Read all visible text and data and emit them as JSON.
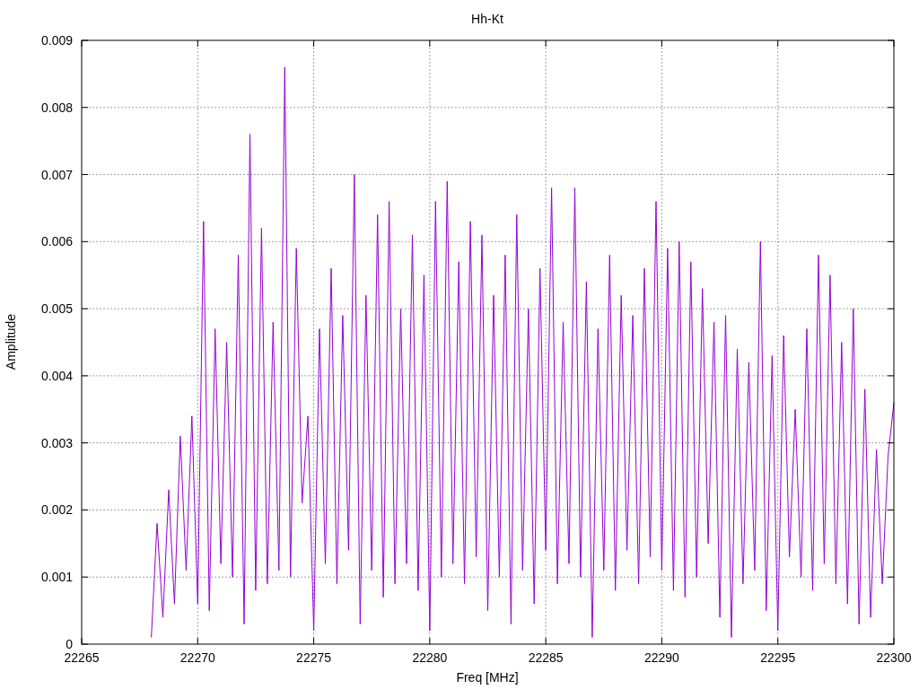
{
  "chart_data": {
    "type": "line",
    "title": "Hh-Kt",
    "xlabel": "Freq [MHz]",
    "ylabel": "Amplitude",
    "xlim": [
      22265,
      22300
    ],
    "ylim": [
      0,
      0.009
    ],
    "grid": true,
    "xticks": [
      22265,
      22270,
      22275,
      22280,
      22285,
      22290,
      22295,
      22300
    ],
    "yticks": [
      {
        "value": 0,
        "label": "0"
      },
      {
        "value": 0.001,
        "label": "0.001"
      },
      {
        "value": 0.002,
        "label": "0.002"
      },
      {
        "value": 0.003,
        "label": "0.003"
      },
      {
        "value": 0.004,
        "label": "0.004"
      },
      {
        "value": 0.005,
        "label": "0.005"
      },
      {
        "value": 0.006,
        "label": "0.006"
      },
      {
        "value": 0.007,
        "label": "0.007"
      },
      {
        "value": 0.008,
        "label": "0.008"
      },
      {
        "value": 0.009,
        "label": "0.009"
      }
    ],
    "x": [
      22268,
      22268.25,
      22268.5,
      22268.75,
      22269,
      22269.25,
      22269.5,
      22269.75,
      22270,
      22270.25,
      22270.5,
      22270.75,
      22271,
      22271.25,
      22271.5,
      22271.75,
      22272,
      22272.25,
      22272.5,
      22272.75,
      22273,
      22273.25,
      22273.5,
      22273.75,
      22274,
      22274.25,
      22274.5,
      22274.75,
      22275,
      22275.25,
      22275.5,
      22275.75,
      22276,
      22276.25,
      22276.5,
      22276.75,
      22277,
      22277.25,
      22277.5,
      22277.75,
      22278,
      22278.25,
      22278.5,
      22278.75,
      22279,
      22279.25,
      22279.5,
      22279.75,
      22280,
      22280.25,
      22280.5,
      22280.75,
      22281,
      22281.25,
      22281.5,
      22281.75,
      22282,
      22282.25,
      22282.5,
      22282.75,
      22283,
      22283.25,
      22283.5,
      22283.75,
      22284,
      22284.25,
      22284.5,
      22284.75,
      22285,
      22285.25,
      22285.5,
      22285.75,
      22286,
      22286.25,
      22286.5,
      22286.75,
      22287,
      22287.25,
      22287.5,
      22287.75,
      22288,
      22288.25,
      22288.5,
      22288.75,
      22289,
      22289.25,
      22289.5,
      22289.75,
      22290,
      22290.25,
      22290.5,
      22290.75,
      22291,
      22291.25,
      22291.5,
      22291.75,
      22292,
      22292.25,
      22292.5,
      22292.75,
      22293,
      22293.25,
      22293.5,
      22293.75,
      22294,
      22294.25,
      22294.5,
      22294.75,
      22295,
      22295.25,
      22295.5,
      22295.75,
      22296,
      22296.25,
      22296.5,
      22296.75,
      22297,
      22297.25,
      22297.5,
      22297.75,
      22298,
      22298.25,
      22298.5,
      22298.75,
      22299,
      22299.25,
      22299.5,
      22299.75,
      22300
    ],
    "series": [
      {
        "color": "#9400d3",
        "values": [
          0.0001,
          0.0018,
          0.0004,
          0.0023,
          0.0006,
          0.0031,
          0.0011,
          0.0034,
          0.0006,
          0.0063,
          0.0005,
          0.0047,
          0.0012,
          0.0045,
          0.001,
          0.0058,
          0.0003,
          0.0076,
          0.0008,
          0.0062,
          0.0009,
          0.0048,
          0.0011,
          0.0086,
          0.001,
          0.0059,
          0.0021,
          0.0034,
          0.0002,
          0.0047,
          0.0012,
          0.0056,
          0.0009,
          0.0049,
          0.0014,
          0.007,
          0.0003,
          0.0052,
          0.0011,
          0.0064,
          0.0007,
          0.0066,
          0.0009,
          0.005,
          0.0012,
          0.0061,
          0.0008,
          0.0055,
          0.0002,
          0.0066,
          0.001,
          0.0069,
          0.0012,
          0.0057,
          0.0009,
          0.0063,
          0.0013,
          0.0061,
          0.0005,
          0.0052,
          0.001,
          0.0058,
          0.0003,
          0.0064,
          0.0011,
          0.005,
          0.0006,
          0.0056,
          0.0014,
          0.0068,
          0.0009,
          0.0048,
          0.0012,
          0.0068,
          0.001,
          0.0054,
          0.0001,
          0.0047,
          0.0011,
          0.0058,
          0.0008,
          0.0052,
          0.0014,
          0.0049,
          0.0009,
          0.0056,
          0.0013,
          0.0066,
          0.0011,
          0.0059,
          0.0008,
          0.006,
          0.0007,
          0.0057,
          0.001,
          0.0053,
          0.0015,
          0.0048,
          0.0004,
          0.0049,
          0.0001,
          0.0044,
          0.0009,
          0.0042,
          0.0011,
          0.006,
          0.0005,
          0.0043,
          0.0002,
          0.0046,
          0.0013,
          0.0035,
          0.001,
          0.0047,
          0.0008,
          0.0058,
          0.0012,
          0.0055,
          0.0009,
          0.0045,
          0.0006,
          0.005,
          0.0003,
          0.0038,
          0.0004,
          0.0029,
          0.0009,
          0.0028,
          0.0036
        ]
      }
    ]
  }
}
